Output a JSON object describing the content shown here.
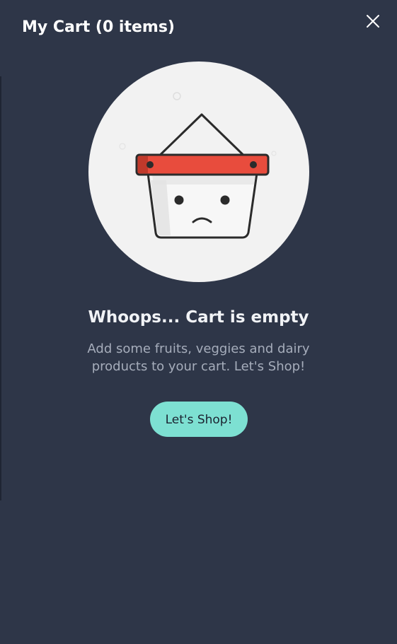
{
  "header": {
    "title": "My Cart (0 items)",
    "close_icon": "close-icon"
  },
  "empty_state": {
    "illustration": "sad-basket-icon",
    "title": "Whoops... Cart is empty",
    "subtitle": "Add some fruits, veggies and dairy products to your cart. Let's Shop!",
    "button_label": "Let's Shop!"
  },
  "colors": {
    "background": "#2e3648",
    "accent": "#7de0d2",
    "basket_rim": "#e84c3d",
    "illustration_bg": "#f2f2f2"
  }
}
